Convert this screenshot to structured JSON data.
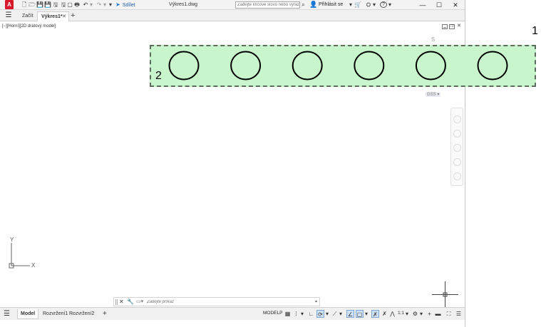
{
  "app": {
    "logo_letter": "A",
    "share_label": "Sdílet",
    "document_title": "Výkres1.dwg",
    "search_placeholder": "Zadejte klíčové slovo nebo výraz",
    "sign_in_label": "Přihlásit se",
    "help_label": "?"
  },
  "tabs": [
    {
      "label": "Začít"
    },
    {
      "label": "Výkres1*"
    }
  ],
  "viewport": {
    "label": "[−][Horní][2D drátový model]",
    "compass_letter": "S",
    "wcs_label": "GSS"
  },
  "ucs": {
    "y_label": "Y",
    "x_label": "X"
  },
  "command_line": {
    "placeholder": "Zadejte příkaz"
  },
  "status_bar": {
    "layout_tabs": [
      "Model",
      "Rozvržení1",
      "Rozvržení2"
    ],
    "modelp_label": "MODELP",
    "annotation_scale": "1:1"
  },
  "annotations": {
    "callout_1": "1",
    "callout_2": "2",
    "highlight_color": "#c8f5cb",
    "circle_count": 6
  }
}
